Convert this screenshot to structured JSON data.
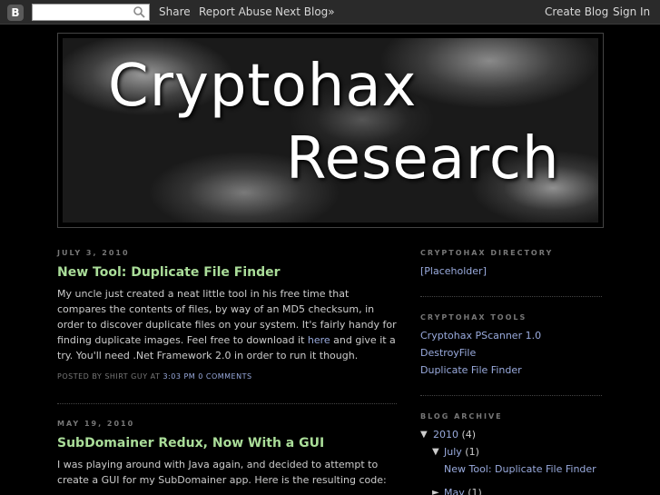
{
  "navbar": {
    "logo_glyph": "B",
    "search_value": "",
    "share": "Share",
    "report_abuse": "Report Abuse",
    "next_blog": "Next Blog»",
    "create_blog": "Create Blog",
    "sign_in": "Sign In"
  },
  "header": {
    "title_line1": "Cryptohax",
    "title_line2": "Research"
  },
  "posts": [
    {
      "date": "JULY 3, 2010",
      "title": "New Tool: Duplicate File Finder",
      "body_before_link": "My uncle just created a neat little tool in his free time that compares the contents of files, by way of an MD5 checksum, in order to discover duplicate files on your system. It's fairly handy for finding duplicate images. Feel free to download it ",
      "link_text": "here",
      "body_after_link": " and give it a try. You'll need .Net Framework 2.0 in order to run it though.",
      "footer_prefix": "POSTED BY SHIRT GUY AT",
      "time": "3:03 PM",
      "comments": "0 COMMENTS"
    },
    {
      "date": "MAY 19, 2010",
      "title": "SubDomainer Redux, Now With a GUI",
      "body": "I was playing around with Java again, and decided to attempt to create a GUI for my SubDomainer app. Here is the resulting code:"
    }
  ],
  "sidebar": {
    "directory": {
      "heading": "CRYPTOHAX DIRECTORY",
      "items": [
        "[Placeholder]"
      ]
    },
    "tools": {
      "heading": "CRYPTOHAX TOOLS",
      "items": [
        "Cryptohax PScanner 1.0",
        "DestroyFile",
        "Duplicate File Finder"
      ]
    },
    "archive": {
      "heading": "BLOG ARCHIVE",
      "year": "2010",
      "year_count": "(4)",
      "month": "July",
      "month_count": "(1)",
      "post": "New Tool: Duplicate File Finder",
      "next_month": "May",
      "next_month_count": "(1)"
    }
  },
  "colors": {
    "background": "#000000",
    "post_title": "#aadd99",
    "link": "#99aadd",
    "text": "#cccccc"
  }
}
